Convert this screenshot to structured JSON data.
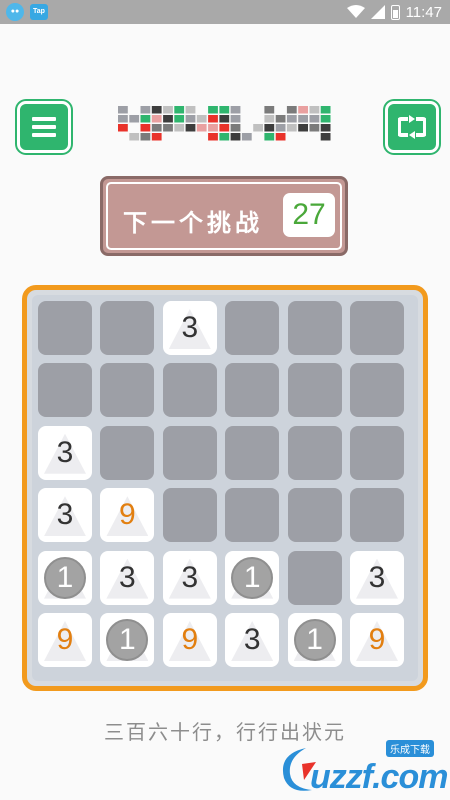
{
  "status_bar": {
    "app_icons": [
      "chat-bubble-icon",
      "tap-app-icon"
    ],
    "app2_label": "Tap",
    "time": "11:47",
    "icons": [
      "wifi-icon",
      "signal-icon",
      "battery-icon"
    ]
  },
  "header": {
    "menu_icon": "hamburger-menu-icon",
    "reload_icon": "reload-icon",
    "accent": "#2fb56e"
  },
  "challenge": {
    "label": "下一个挑战",
    "count": "27",
    "background": "#c39894",
    "count_color": "#4aa83a"
  },
  "board": {
    "border_color": "#f29a1d",
    "rows": 6,
    "cols": 6,
    "cells": [
      [
        "",
        "",
        "3",
        "",
        "",
        ""
      ],
      [
        "",
        "",
        "",
        "",
        "",
        ""
      ],
      [
        "3",
        "",
        "",
        "",
        "",
        ""
      ],
      [
        "3",
        "9",
        "",
        "",
        "",
        ""
      ],
      [
        "1",
        "3",
        "3",
        "1",
        "",
        "3"
      ],
      [
        "9",
        "1",
        "9",
        "3",
        "1",
        "9"
      ]
    ]
  },
  "tagline": "三百六十行，行行出状元",
  "watermark": {
    "text": "uzzf.com",
    "badge": "乐成下载"
  }
}
